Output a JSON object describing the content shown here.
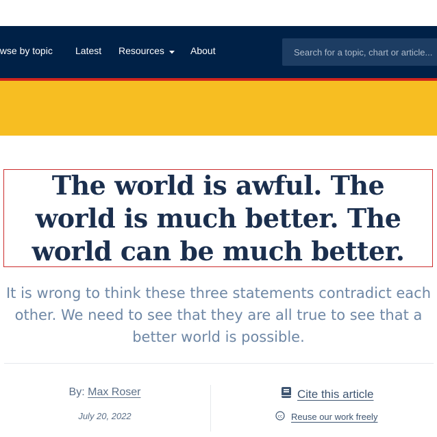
{
  "nav": {
    "items": [
      {
        "label": "owse by topic"
      },
      {
        "label": "Latest"
      },
      {
        "label": "Resources"
      },
      {
        "label": "About"
      }
    ],
    "search_placeholder": "Search for a topic, chart or article...",
    "resources_icon": "chevron-down-icon"
  },
  "colors": {
    "navbar": "#002147",
    "accent_red": "#ce261e",
    "banner_yellow": "#f7be22",
    "title": "#1b2f4e",
    "subtitle": "#6e87a5"
  },
  "article": {
    "title": "The world is awful. The world is much better. The world can be much better.",
    "subtitle": "It is wrong to think these three statements contradict each other. We need to see that they are all true to see that a better world is possible.",
    "by_label": "By:",
    "author": "Max Roser",
    "date": "July 20, 2022",
    "cite_label": "Cite this article",
    "cite_icon": "book-icon",
    "reuse_label": "Reuse our work freely",
    "reuse_icon": "creative-commons-icon"
  }
}
